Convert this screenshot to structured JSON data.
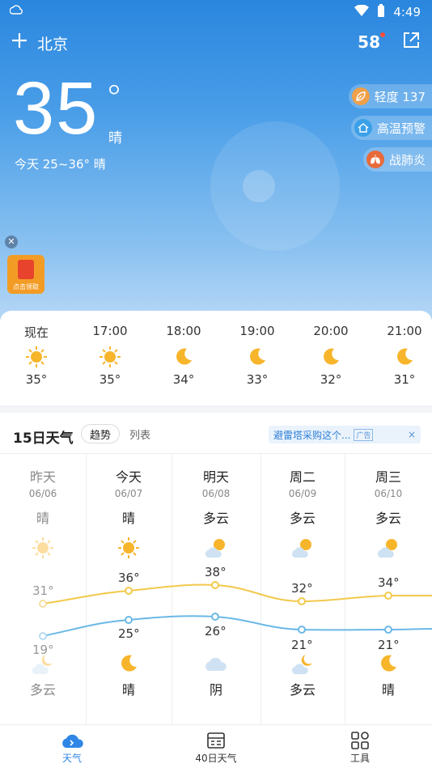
{
  "status_bar": {
    "time": "4:49"
  },
  "header": {
    "city": "北京",
    "badge": "58"
  },
  "current": {
    "temp": "35",
    "degree_symbol": "°",
    "condition": "晴",
    "today_range": "今天 25~36°  晴"
  },
  "pills": [
    {
      "label": "轻度 137",
      "icon": "leaf-icon",
      "color": "#f0a04a"
    },
    {
      "label": "高温预警",
      "icon": "heat-warning-icon",
      "color": "#3aa0e8"
    },
    {
      "label": "战肺炎",
      "icon": "lungs-icon",
      "color": "#e86a3a"
    }
  ],
  "ad_float": {
    "text": "点击领取"
  },
  "hourly": [
    {
      "time": "现在",
      "temp": "35°",
      "icon": "sun-icon"
    },
    {
      "time": "17:00",
      "temp": "35°",
      "icon": "sun-icon"
    },
    {
      "time": "18:00",
      "temp": "34°",
      "icon": "moon-icon"
    },
    {
      "time": "19:00",
      "temp": "33°",
      "icon": "moon-icon"
    },
    {
      "time": "20:00",
      "temp": "32°",
      "icon": "moon-icon"
    },
    {
      "time": "21:00",
      "temp": "31°",
      "icon": "moon-icon"
    }
  ],
  "daily_section": {
    "title": "15日天气",
    "tab_trend": "趋势",
    "tab_list": "列表",
    "ad_text": "避雷塔采购这个...",
    "ad_tag": "广告",
    "ad_close": "×"
  },
  "days": [
    {
      "name": "昨天",
      "date": "06/06",
      "day_cond": "晴",
      "day_icon": "sun-icon",
      "high": "31°",
      "low": "19°",
      "night_icon": "partly-cloudy-night-icon",
      "night_cond": "多云",
      "past": true
    },
    {
      "name": "今天",
      "date": "06/07",
      "day_cond": "晴",
      "day_icon": "sun-icon",
      "high": "36°",
      "low": "25°",
      "night_icon": "moon-icon",
      "night_cond": "晴",
      "past": false
    },
    {
      "name": "明天",
      "date": "06/08",
      "day_cond": "多云",
      "day_icon": "partly-cloudy-icon",
      "high": "38°",
      "low": "26°",
      "night_icon": "cloud-icon",
      "night_cond": "阴",
      "past": false
    },
    {
      "name": "周二",
      "date": "06/09",
      "day_cond": "多云",
      "day_icon": "partly-cloudy-icon",
      "high": "32°",
      "low": "21°",
      "night_icon": "partly-cloudy-night-icon",
      "night_cond": "多云",
      "past": false
    },
    {
      "name": "周三",
      "date": "06/10",
      "day_cond": "多云",
      "day_icon": "partly-cloudy-icon",
      "high": "34°",
      "low": "21°",
      "night_icon": "moon-icon",
      "night_cond": "晴",
      "past": false
    }
  ],
  "tabs": [
    {
      "label": "天气",
      "icon": "cloud-tab-icon",
      "active": true
    },
    {
      "label": "40日天气",
      "icon": "calendar-icon",
      "active": false
    },
    {
      "label": "工具",
      "icon": "grid-icon",
      "active": false
    }
  ],
  "colors": {
    "accent": "#2f86e6",
    "high_line": "#f2c94c",
    "low_line": "#6bb8e6"
  }
}
